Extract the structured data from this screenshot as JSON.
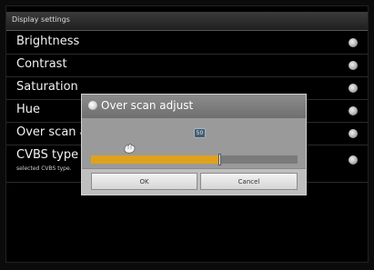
{
  "window": {
    "title": "Display settings"
  },
  "settings": [
    {
      "label": "Brightness"
    },
    {
      "label": "Contrast"
    },
    {
      "label": "Saturation"
    },
    {
      "label": "Hue"
    },
    {
      "label": "Over scan adj"
    },
    {
      "label": "CVBS type",
      "sub": "selected CVBS type."
    }
  ],
  "dialog": {
    "title": "Over scan adjust",
    "value": "50",
    "slider_fraction": 0.62,
    "ok_label": "OK",
    "cancel_label": "Cancel"
  },
  "colors": {
    "accent": "#e0a21b"
  }
}
